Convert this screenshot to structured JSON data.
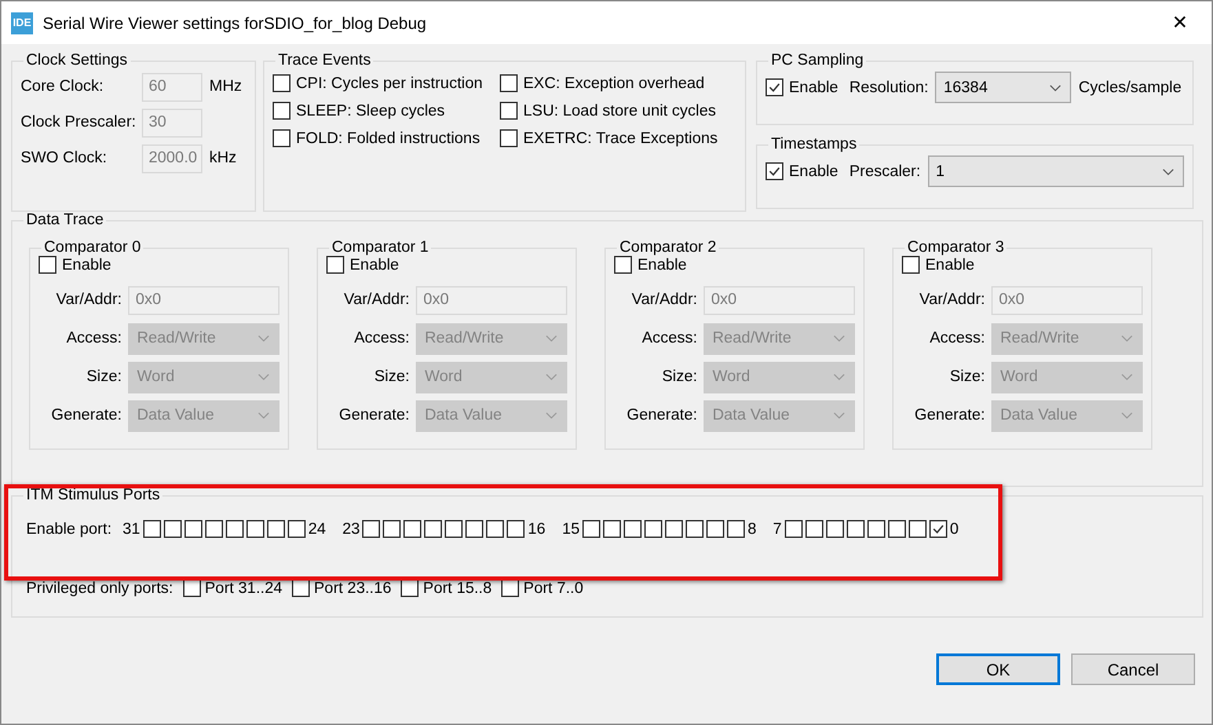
{
  "window": {
    "app_icon": "IDE",
    "title": "Serial Wire Viewer settings forSDIO_for_blog Debug",
    "close": "✕"
  },
  "clock_settings": {
    "title": "Clock Settings",
    "rows": [
      {
        "label": "Core Clock:",
        "value": "60",
        "unit": "MHz"
      },
      {
        "label": "Clock Prescaler:",
        "value": "30"
      },
      {
        "label": "SWO Clock:",
        "value": "2000.0",
        "unit": "kHz"
      }
    ]
  },
  "trace_events": {
    "title": "Trace Events",
    "items": [
      {
        "label": "CPI: Cycles per instruction",
        "checked": false
      },
      {
        "label": "EXC: Exception overhead",
        "checked": false
      },
      {
        "label": "SLEEP: Sleep cycles",
        "checked": false
      },
      {
        "label": "LSU: Load store unit cycles",
        "checked": false
      },
      {
        "label": "FOLD: Folded instructions",
        "checked": false
      },
      {
        "label": "EXETRC: Trace Exceptions",
        "checked": false
      }
    ]
  },
  "pc_sampling": {
    "title": "PC Sampling",
    "enable": {
      "label": "Enable",
      "checked": true
    },
    "resolution_label": "Resolution:",
    "resolution_value": "16384",
    "unit": "Cycles/sample"
  },
  "timestamps": {
    "title": "Timestamps",
    "enable": {
      "label": "Enable",
      "checked": true
    },
    "prescaler_label": "Prescaler:",
    "prescaler_value": "1"
  },
  "data_trace": {
    "title": "Data Trace",
    "comparators": [
      {
        "title": "Comparator 0",
        "enable": {
          "label": "Enable",
          "checked": false
        },
        "fields": [
          {
            "label": "Var/Addr:",
            "value": "0x0",
            "kind": "text"
          },
          {
            "label": "Access:",
            "value": "Read/Write",
            "kind": "combo"
          },
          {
            "label": "Size:",
            "value": "Word",
            "kind": "combo"
          },
          {
            "label": "Generate:",
            "value": "Data Value",
            "kind": "combo"
          }
        ]
      },
      {
        "title": "Comparator 1",
        "enable": {
          "label": "Enable",
          "checked": false
        },
        "fields": [
          {
            "label": "Var/Addr:",
            "value": "0x0",
            "kind": "text"
          },
          {
            "label": "Access:",
            "value": "Read/Write",
            "kind": "combo"
          },
          {
            "label": "Size:",
            "value": "Word",
            "kind": "combo"
          },
          {
            "label": "Generate:",
            "value": "Data Value",
            "kind": "combo"
          }
        ]
      },
      {
        "title": "Comparator 2",
        "enable": {
          "label": "Enable",
          "checked": false
        },
        "fields": [
          {
            "label": "Var/Addr:",
            "value": "0x0",
            "kind": "text"
          },
          {
            "label": "Access:",
            "value": "Read/Write",
            "kind": "combo"
          },
          {
            "label": "Size:",
            "value": "Word",
            "kind": "combo"
          },
          {
            "label": "Generate:",
            "value": "Data Value",
            "kind": "combo"
          }
        ]
      },
      {
        "title": "Comparator 3",
        "enable": {
          "label": "Enable",
          "checked": false
        },
        "fields": [
          {
            "label": "Var/Addr:",
            "value": "0x0",
            "kind": "text"
          },
          {
            "label": "Access:",
            "value": "Read/Write",
            "kind": "combo"
          },
          {
            "label": "Size:",
            "value": "Word",
            "kind": "combo"
          },
          {
            "label": "Generate:",
            "value": "Data Value",
            "kind": "combo"
          }
        ]
      }
    ]
  },
  "itm": {
    "title": "ITM Stimulus Ports",
    "enable_label": "Enable port:",
    "groups": [
      {
        "high": "31",
        "low": "24",
        "ports": [
          {
            "checked": false
          },
          {
            "checked": false
          },
          {
            "checked": false
          },
          {
            "checked": false
          },
          {
            "checked": false
          },
          {
            "checked": false
          },
          {
            "checked": false
          },
          {
            "checked": false
          }
        ]
      },
      {
        "high": "23",
        "low": "16",
        "ports": [
          {
            "checked": false
          },
          {
            "checked": false
          },
          {
            "checked": false
          },
          {
            "checked": false
          },
          {
            "checked": false
          },
          {
            "checked": false
          },
          {
            "checked": false
          },
          {
            "checked": false
          }
        ]
      },
      {
        "high": "15",
        "low": "8",
        "ports": [
          {
            "checked": false
          },
          {
            "checked": false
          },
          {
            "checked": false
          },
          {
            "checked": false
          },
          {
            "checked": false
          },
          {
            "checked": false
          },
          {
            "checked": false
          },
          {
            "checked": false
          }
        ]
      },
      {
        "high": "7",
        "low": "0",
        "ports": [
          {
            "checked": false
          },
          {
            "checked": false
          },
          {
            "checked": false
          },
          {
            "checked": false
          },
          {
            "checked": false
          },
          {
            "checked": false
          },
          {
            "checked": false
          },
          {
            "checked": true
          }
        ]
      }
    ],
    "privileged_label": "Privileged only ports:",
    "privileged": [
      {
        "label": "Port 31..24",
        "checked": false
      },
      {
        "label": "Port 23..16",
        "checked": false
      },
      {
        "label": "Port 15..8",
        "checked": false
      },
      {
        "label": "Port 7..0",
        "checked": false
      }
    ]
  },
  "buttons": [
    {
      "label": "OK",
      "default": true
    },
    {
      "label": "Cancel",
      "default": false
    }
  ]
}
